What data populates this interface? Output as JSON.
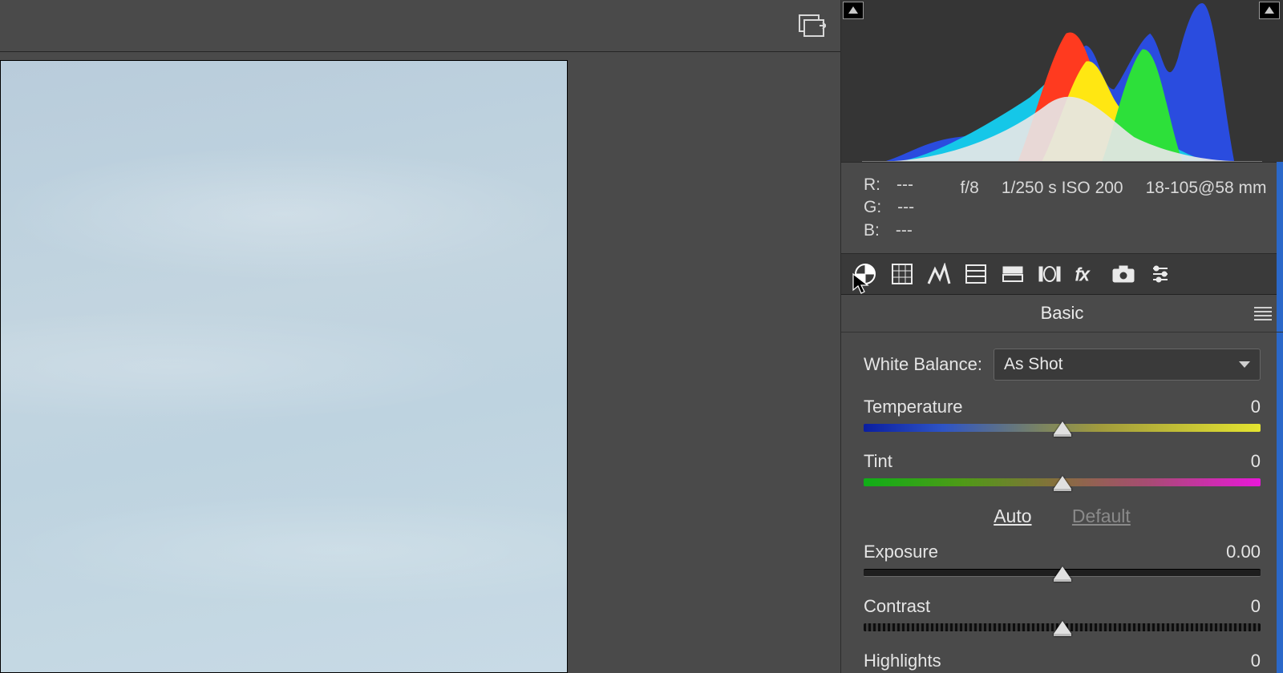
{
  "rgb": {
    "r_label": "R:",
    "g_label": "G:",
    "b_label": "B:",
    "r_val": "---",
    "g_val": "---",
    "b_val": "---"
  },
  "exif": {
    "aperture": "f/8",
    "shutter": "1/250 s",
    "iso": "ISO 200",
    "lens": "18-105@58 mm"
  },
  "panel_title": "Basic",
  "wb": {
    "label": "White Balance:",
    "value": "As Shot"
  },
  "sliders": {
    "temperature": {
      "label": "Temperature",
      "value": "0"
    },
    "tint": {
      "label": "Tint",
      "value": "0"
    },
    "exposure": {
      "label": "Exposure",
      "value": "0.00"
    },
    "contrast": {
      "label": "Contrast",
      "value": "0"
    },
    "highlights": {
      "label": "Highlights",
      "value": "0"
    }
  },
  "actions": {
    "auto": "Auto",
    "default": "Default"
  },
  "tabs": [
    "basic",
    "curve",
    "detail",
    "hsl",
    "split",
    "lens",
    "fx",
    "camera",
    "presets"
  ]
}
